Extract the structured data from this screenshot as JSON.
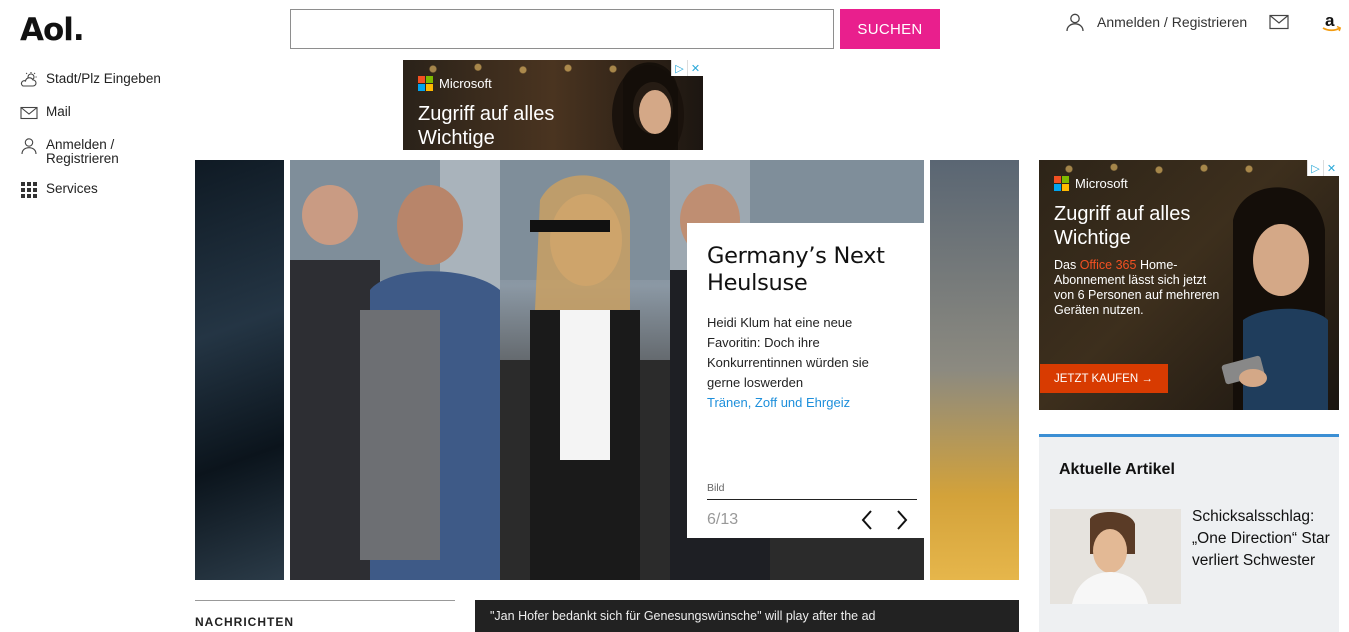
{
  "header": {
    "logo": "Aol.",
    "search_placeholder": "",
    "search_button": "SUCHEN",
    "login_label": "Anmelden / Registrieren"
  },
  "sidebar": {
    "items": [
      {
        "label": "Stadt/Plz Eingeben",
        "icon": "weather-icon"
      },
      {
        "label": "Mail",
        "icon": "mail-icon"
      },
      {
        "label": "Anmelden / Registrieren",
        "icon": "user-icon"
      },
      {
        "label": "Services",
        "icon": "grid-icon"
      }
    ]
  },
  "ads": {
    "top": {
      "brand": "Microsoft",
      "headline": "Zugriff auf alles Wichtige"
    },
    "right": {
      "brand": "Microsoft",
      "headline": "Zugriff auf alles Wichtige",
      "body_pre": "Das ",
      "body_highlight": "Office 365",
      "body_post": " Home-Abonnement lässt sich jetzt von 6 Personen auf mehreren Geräten nutzen.",
      "cta": "JETZT KAUFEN →"
    }
  },
  "slideshow": {
    "title": "Germany’s Next Heulsuse",
    "description": "Heidi Klum hat eine neue Favoritin: Doch ihre Konkurrentinnen würden sie gerne loswerden",
    "link": "Tränen, Zoff und Ehrgeiz",
    "category": "Bild",
    "counter": "6/13"
  },
  "aktuelle": {
    "heading": "Aktuelle Artikel",
    "article_title": "Schicksalsschlag: „One Direction“ Star verliert Schwester"
  },
  "nachrichten": {
    "heading": "NACHRICHTEN"
  },
  "video": {
    "text": "\"Jan Hofer bedankt sich für Genesungswünsche\" will play after the ad"
  },
  "colors": {
    "accent_pink": "#e91f8d",
    "link_blue": "#1d8fdb",
    "section_blue": "#3b8fd4",
    "ad_cta": "#d83b01"
  }
}
